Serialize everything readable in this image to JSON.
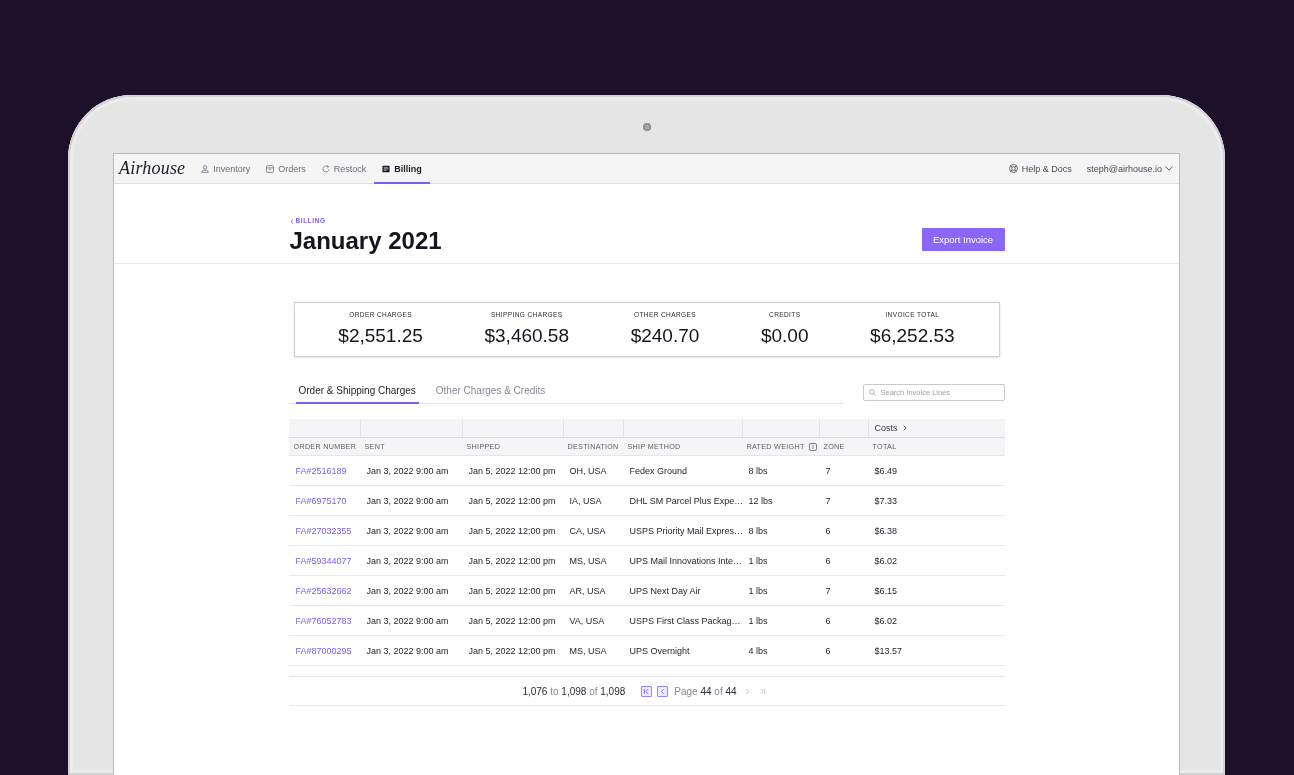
{
  "nav": {
    "logo": "Airhouse",
    "items": [
      {
        "label": "Inventory",
        "selected": false
      },
      {
        "label": "Orders",
        "selected": false
      },
      {
        "label": "Restock",
        "selected": false
      },
      {
        "label": "Billing",
        "selected": true
      }
    ],
    "help_link": "Help & Docs",
    "account": "steph@airhouse.io"
  },
  "header": {
    "breadcrumb": "BILLING",
    "title": "January 2021",
    "export_button": "Export Invoice"
  },
  "summary": [
    {
      "label": "ORDER CHARGES",
      "value": "$2,551.25"
    },
    {
      "label": "SHIPPING CHARGES",
      "value": "$3,460.58"
    },
    {
      "label": "OTHER CHARGES",
      "value": "$240.70"
    },
    {
      "label": "CREDITS",
      "value": "$0.00"
    },
    {
      "label": "INVOICE TOTAL",
      "value": "$6,252.53"
    }
  ],
  "tabs": [
    {
      "label": "Order & Shipping Charges",
      "selected": true
    },
    {
      "label": "Other Charges & Credits",
      "selected": false
    }
  ],
  "search": {
    "placeholder": "Search Invoice Lines"
  },
  "table": {
    "column_group": "Costs",
    "columns": [
      {
        "label": "ORDER NUMBER",
        "info": false
      },
      {
        "label": "SENT",
        "info": false
      },
      {
        "label": "SHIPPED",
        "info": false
      },
      {
        "label": "DESTINATION",
        "info": false
      },
      {
        "label": "SHIP METHOD",
        "info": false
      },
      {
        "label": "RATED WEIGHT",
        "info": true
      },
      {
        "label": "ZONE",
        "info": false
      },
      {
        "label": "TOTAL",
        "info": false
      }
    ],
    "rows": [
      {
        "order_number": "FA#2516189",
        "sent": "Jan 3, 2022 9:00 am",
        "shipped": "Jan 5, 2022 12:00 pm",
        "destination": "OH, USA",
        "ship_method": "Fedex Ground",
        "rated_weight": "8 lbs",
        "zone": "7",
        "total": "$6.49"
      },
      {
        "order_number": "FA#6975170",
        "sent": "Jan 3, 2022 9:00 am",
        "shipped": "Jan 5, 2022 12:00 pm",
        "destination": "IA, USA",
        "ship_method": "DHL SM Parcel Plus Expe…",
        "rated_weight": "12 lbs",
        "zone": "7",
        "total": "$7.33"
      },
      {
        "order_number": "FA#27032355",
        "sent": "Jan 3, 2022 9:00 am",
        "shipped": "Jan 5, 2022 12:00 pm",
        "destination": "CA, USA",
        "ship_method": "USPS Priority Mail Expres…",
        "rated_weight": "8 lbs",
        "zone": "6",
        "total": "$6.38"
      },
      {
        "order_number": "FA#59344077",
        "sent": "Jan 3, 2022 9:00 am",
        "shipped": "Jan 5, 2022 12:00 pm",
        "destination": "MS, USA",
        "ship_method": "UPS Mail Innovations Inte…",
        "rated_weight": "1 lbs",
        "zone": "6",
        "total": "$6.02"
      },
      {
        "order_number": "FA#25632662",
        "sent": "Jan 3, 2022 9:00 am",
        "shipped": "Jan 5, 2022 12:00 pm",
        "destination": "AR, USA",
        "ship_method": "UPS Next Day Air",
        "rated_weight": "1 lbs",
        "zone": "7",
        "total": "$6.15"
      },
      {
        "order_number": "FA#76052783",
        "sent": "Jan 3, 2022 9:00 am",
        "shipped": "Jan 5, 2022 12:00 pm",
        "destination": "VA, USA",
        "ship_method": "USPS First Class Packag…",
        "rated_weight": "1 lbs",
        "zone": "6",
        "total": "$6.02"
      },
      {
        "order_number": "FA#87000295",
        "sent": "Jan 3, 2022 9:00 am",
        "shipped": "Jan 5, 2022 12:00 pm",
        "destination": "MS, USA",
        "ship_method": "UPS Overnight",
        "rated_weight": "4 lbs",
        "zone": "6",
        "total": "$13.57"
      }
    ]
  },
  "pagination": {
    "range": "**1,076** to **1,098** of **1,098**",
    "page": "Page **44** of **44**",
    "buttons": [
      {
        "kind": "first",
        "disabled": false
      },
      {
        "kind": "previous",
        "disabled": false
      },
      {
        "kind": "next",
        "disabled": true
      },
      {
        "kind": "last",
        "disabled": true
      }
    ]
  }
}
